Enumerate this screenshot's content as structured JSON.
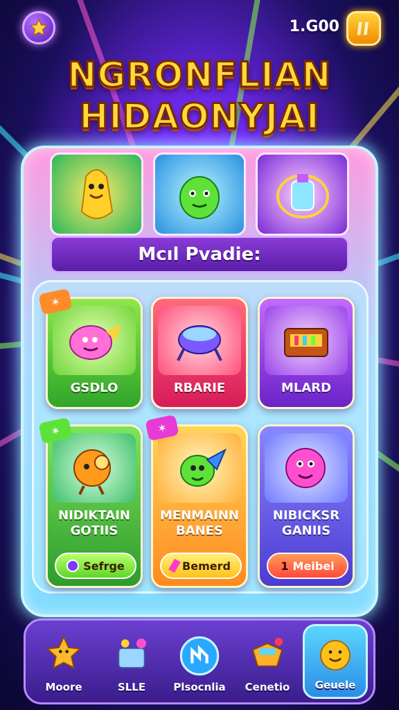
{
  "header": {
    "coins": "1.G00",
    "title_line1": "NGRONFLIAN",
    "title_line2": "HIDAONYJAI"
  },
  "banner": {
    "label": "Mcıl Pvadie:"
  },
  "cards": [
    {
      "name": "GSDLO",
      "color_top": "#8ee84a",
      "color_bottom": "#2fa62a",
      "icon": "pink-creature-icon"
    },
    {
      "name": "RBARIE",
      "color_top": "#ff6b7a",
      "color_bottom": "#d81b5a",
      "icon": "robot-pod-icon"
    },
    {
      "name": "MLARD",
      "color_top": "#c46bff",
      "color_bottom": "#6a22c8",
      "icon": "treasure-chest-icon"
    },
    {
      "name_line1": "NIDIKTAIN",
      "name_line2": "GOTIIS",
      "button": "Sefrge",
      "color_top": "#7de55a",
      "color_bottom": "#2e9b2c",
      "icon": "orange-robot-icon"
    },
    {
      "name_line1": "MENMAINN",
      "name_line2": "BANES",
      "button": "Bemerd",
      "color_top": "#ffd45a",
      "color_bottom": "#ff8a1e",
      "icon": "rocket-creature-icon"
    },
    {
      "name_line1": "NIBICKSR",
      "name_line2": "GANIIS",
      "button": "Meibei",
      "button_prefix": "1",
      "color_top": "#8a86ff",
      "color_bottom": "#4c3bd1",
      "icon": "pink-blob-icon"
    }
  ],
  "nav": [
    {
      "label": "Moore",
      "icon": "star-creature-icon"
    },
    {
      "label": "SLLE",
      "icon": "gift-box-icon"
    },
    {
      "label": "Plsocnlia",
      "icon": "blue-orb-icon"
    },
    {
      "label": "Cenetio",
      "icon": "treasure-icon"
    },
    {
      "label": "Geuele",
      "icon": "smiley-icon"
    }
  ]
}
